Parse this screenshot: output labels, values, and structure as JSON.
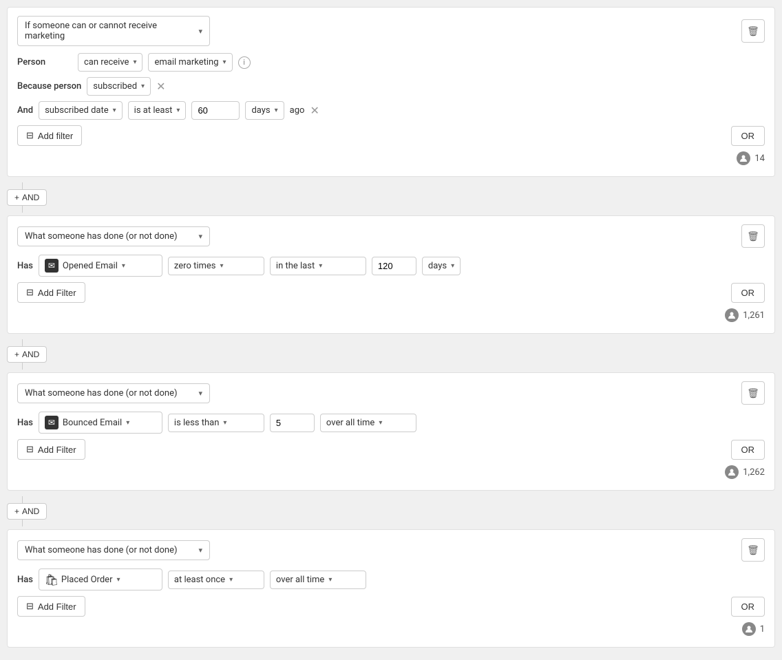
{
  "block1": {
    "main_dropdown": "If someone can or cannot receive marketing",
    "person_label": "Person",
    "can_receive_label": "can receive",
    "email_marketing_label": "email marketing",
    "because_label": "Because person",
    "subscribed_label": "subscribed",
    "and_label": "And",
    "subscribed_date_label": "subscribed date",
    "is_at_least_label": "is at least",
    "days_value": "60",
    "days_label": "days",
    "ago_label": "ago",
    "add_filter_label": "Add filter",
    "or_label": "OR",
    "count": "14"
  },
  "block2": {
    "main_dropdown": "What someone has done (or not done)",
    "has_label": "Has",
    "event_label": "Opened Email",
    "frequency_label": "zero times",
    "time_range_label": "in the last",
    "time_value": "120",
    "time_unit_label": "days",
    "add_filter_label": "Add Filter",
    "or_label": "OR",
    "count": "1,261"
  },
  "block3": {
    "main_dropdown": "What someone has done (or not done)",
    "has_label": "Has",
    "event_label": "Bounced Email",
    "frequency_label": "is less than",
    "count_value": "5",
    "time_range_label": "over all time",
    "add_filter_label": "Add Filter",
    "or_label": "OR",
    "count": "1,262"
  },
  "block4": {
    "main_dropdown": "What someone has done (or not done)",
    "has_label": "Has",
    "event_label": "Placed Order",
    "frequency_label": "at least once",
    "time_range_label": "over all time",
    "add_filter_label": "Add Filter",
    "or_label": "OR",
    "count": "1"
  },
  "and_button_label": "+ AND",
  "trash_icon": "🗑",
  "filter_icon": "⊟",
  "plus_icon": "+"
}
